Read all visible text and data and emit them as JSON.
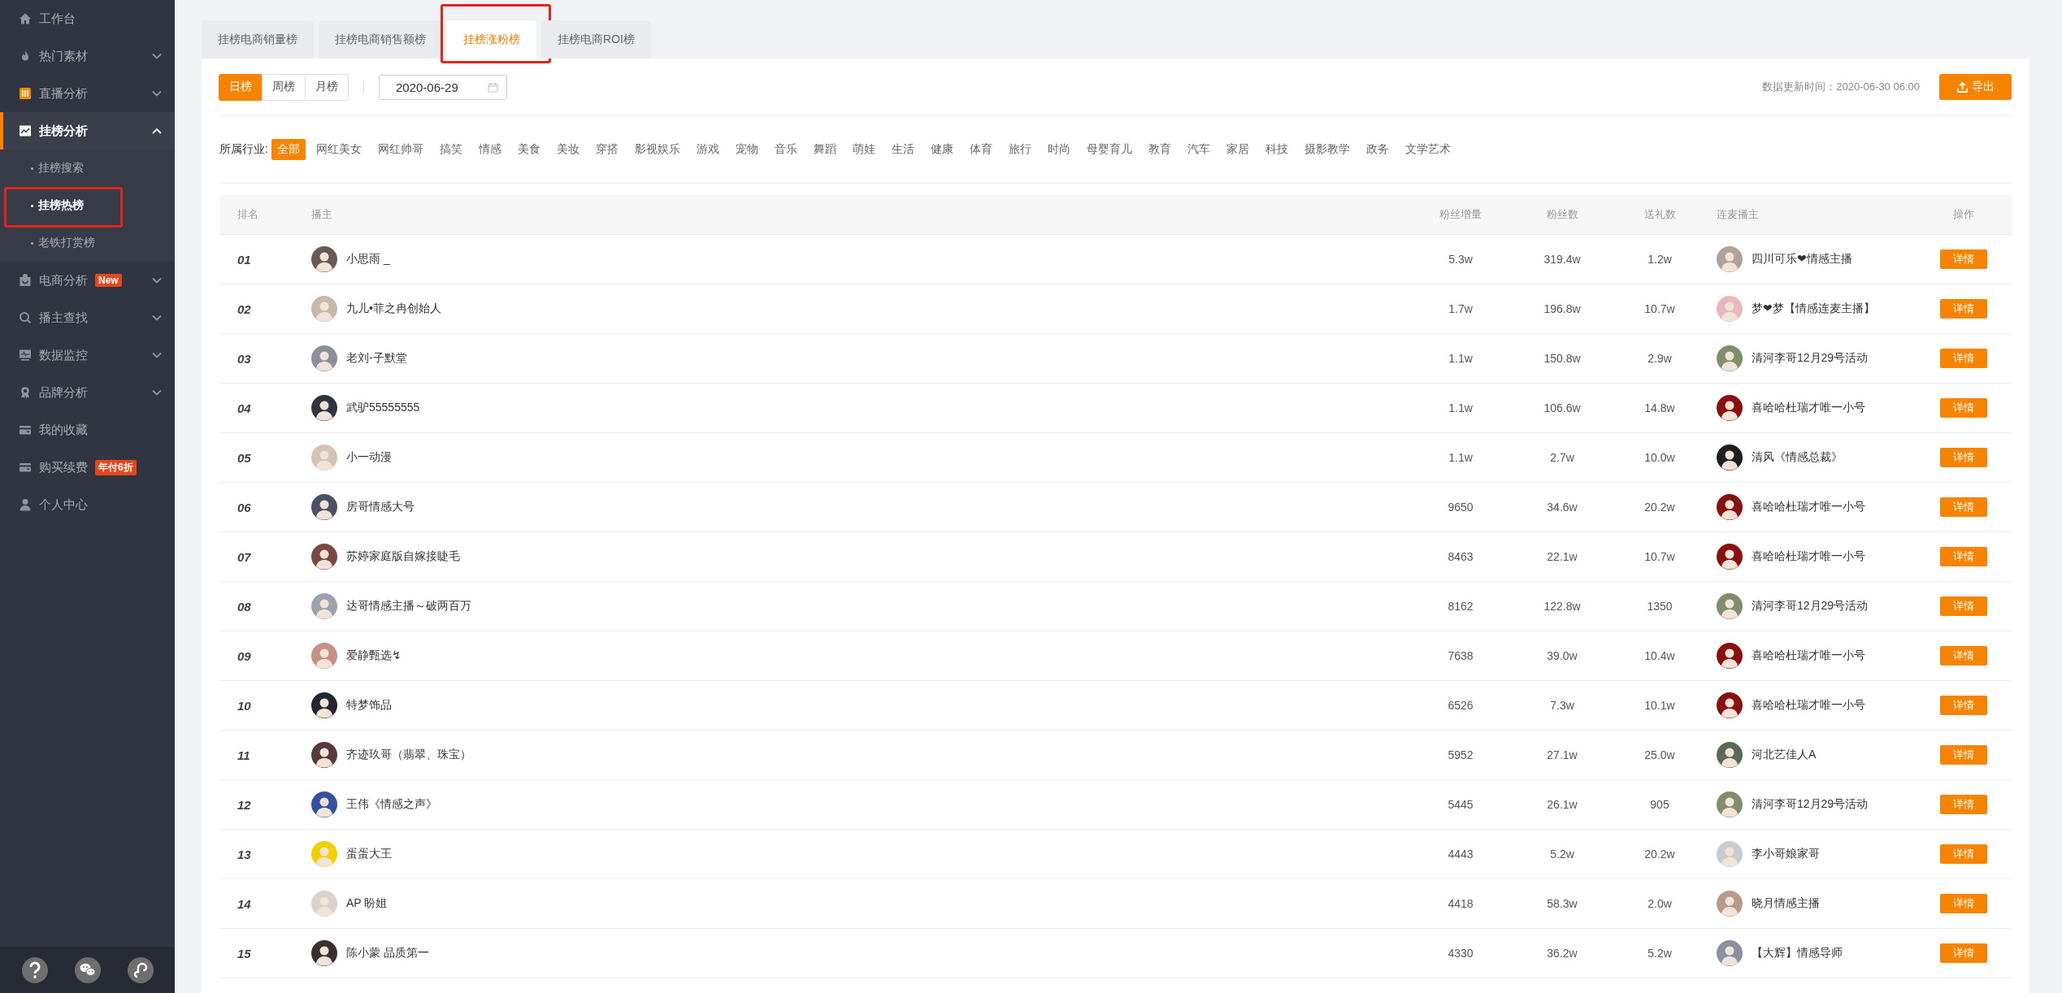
{
  "sidebar": {
    "items": [
      {
        "label": "工作台",
        "selected": false
      },
      {
        "label": "热门素材",
        "selected": false,
        "expanded": false
      },
      {
        "label": "直播分析",
        "selected": false,
        "expanded": false
      },
      {
        "label": "挂榜分析",
        "selected": true,
        "expanded": true,
        "children": [
          {
            "label": "挂榜搜索",
            "selected": false,
            "highlighted": false
          },
          {
            "label": "挂榜热榜",
            "selected": true,
            "highlighted": true
          },
          {
            "label": "老铁打赏榜",
            "selected": false,
            "highlighted": false
          }
        ]
      },
      {
        "label": "电商分析",
        "selected": false,
        "expanded": false,
        "badge": "New"
      },
      {
        "label": "播主查找",
        "selected": false,
        "expanded": false
      },
      {
        "label": "数据监控",
        "selected": false,
        "expanded": false
      },
      {
        "label": "品牌分析",
        "selected": false,
        "expanded": false
      },
      {
        "label": "我的收藏",
        "selected": false
      },
      {
        "label": "购买续费",
        "selected": false,
        "badge": "年付6折"
      },
      {
        "label": "个人中心",
        "selected": false
      }
    ]
  },
  "tabs": [
    {
      "label": "挂榜电商销量榜",
      "selected": false,
      "highlighted": false
    },
    {
      "label": "挂榜电商销售额榜",
      "selected": false,
      "highlighted": false
    },
    {
      "label": "挂榜涨粉榜",
      "selected": true,
      "highlighted": true
    },
    {
      "label": "挂榜电商ROI榜",
      "selected": false,
      "highlighted": false
    }
  ],
  "periods": [
    {
      "label": "日榜",
      "selected": true
    },
    {
      "label": "周榜",
      "selected": false
    },
    {
      "label": "月榜",
      "selected": false
    }
  ],
  "date_field": {
    "value": "2020-06-29"
  },
  "update_time": "数据更新时间：2020-06-30 06:00",
  "export_button": "导出",
  "industry": {
    "label": "所属行业:",
    "options": [
      {
        "label": "全部",
        "selected": true
      },
      {
        "label": "网红美女",
        "selected": false
      },
      {
        "label": "网红帅哥",
        "selected": false
      },
      {
        "label": "搞笑",
        "selected": false
      },
      {
        "label": "情感",
        "selected": false
      },
      {
        "label": "美食",
        "selected": false
      },
      {
        "label": "美妆",
        "selected": false
      },
      {
        "label": "穿搭",
        "selected": false
      },
      {
        "label": "影视娱乐",
        "selected": false
      },
      {
        "label": "游戏",
        "selected": false
      },
      {
        "label": "宠物",
        "selected": false
      },
      {
        "label": "音乐",
        "selected": false
      },
      {
        "label": "舞蹈",
        "selected": false
      },
      {
        "label": "萌娃",
        "selected": false
      },
      {
        "label": "生活",
        "selected": false
      },
      {
        "label": "健康",
        "selected": false
      },
      {
        "label": "体育",
        "selected": false
      },
      {
        "label": "旅行",
        "selected": false
      },
      {
        "label": "时尚",
        "selected": false
      },
      {
        "label": "母婴育儿",
        "selected": false
      },
      {
        "label": "教育",
        "selected": false
      },
      {
        "label": "汽车",
        "selected": false
      },
      {
        "label": "家居",
        "selected": false
      },
      {
        "label": "科技",
        "selected": false
      },
      {
        "label": "摄影教学",
        "selected": false
      },
      {
        "label": "政务",
        "selected": false
      },
      {
        "label": "文学艺术",
        "selected": false
      }
    ]
  },
  "table": {
    "columns": [
      "排名",
      "播主",
      "粉丝增量",
      "粉丝数",
      "送礼数",
      "连麦播主",
      "操作"
    ],
    "rows": [
      {
        "rank": "01",
        "anchor": "小思雨 _",
        "fan_increase": "5.3w",
        "fans": "319.4w",
        "gifts": "1.2w",
        "partner": "四川可乐❤情感主播",
        "action": "详情"
      },
      {
        "rank": "02",
        "anchor": "九儿•菲之冉创始人",
        "fan_increase": "1.7w",
        "fans": "196.8w",
        "gifts": "10.7w",
        "partner": "梦❤梦【情感连麦主播】",
        "action": "详情"
      },
      {
        "rank": "03",
        "anchor": "老刘-子默堂",
        "fan_increase": "1.1w",
        "fans": "150.8w",
        "gifts": "2.9w",
        "partner": "清河李哥12月29号活动",
        "action": "详情"
      },
      {
        "rank": "04",
        "anchor": "武驴55555555",
        "fan_increase": "1.1w",
        "fans": "106.6w",
        "gifts": "14.8w",
        "partner": "喜哈哈杜瑞才唯一小号",
        "action": "详情"
      },
      {
        "rank": "05",
        "anchor": "小一动漫",
        "fan_increase": "1.1w",
        "fans": "2.7w",
        "gifts": "10.0w",
        "partner": "清风《情感总裁》",
        "action": "详情"
      },
      {
        "rank": "06",
        "anchor": "房哥情感大号",
        "fan_increase": "9650",
        "fans": "34.6w",
        "gifts": "20.2w",
        "partner": "喜哈哈杜瑞才唯一小号",
        "action": "详情"
      },
      {
        "rank": "07",
        "anchor": "苏婷家庭版自嫁接睫毛",
        "fan_increase": "8463",
        "fans": "22.1w",
        "gifts": "10.7w",
        "partner": "喜哈哈杜瑞才唯一小号",
        "action": "详情"
      },
      {
        "rank": "08",
        "anchor": "达哥情感主播～破两百万",
        "fan_increase": "8162",
        "fans": "122.8w",
        "gifts": "1350",
        "partner": "清河李哥12月29号活动",
        "action": "详情"
      },
      {
        "rank": "09",
        "anchor": "爱静甄选↯",
        "fan_increase": "7638",
        "fans": "39.0w",
        "gifts": "10.4w",
        "partner": "喜哈哈杜瑞才唯一小号",
        "action": "详情"
      },
      {
        "rank": "10",
        "anchor": "特梦饰品",
        "fan_increase": "6526",
        "fans": "7.3w",
        "gifts": "10.1w",
        "partner": "喜哈哈杜瑞才唯一小号",
        "action": "详情"
      },
      {
        "rank": "11",
        "anchor": "齐迹玖哥（翡翠、珠宝）",
        "fan_increase": "5952",
        "fans": "27.1w",
        "gifts": "25.0w",
        "partner": "河北艺佳人A",
        "action": "详情"
      },
      {
        "rank": "12",
        "anchor": "王伟《情感之声》",
        "fan_increase": "5445",
        "fans": "26.1w",
        "gifts": "905",
        "partner": "清河李哥12月29号活动",
        "action": "详情"
      },
      {
        "rank": "13",
        "anchor": "蛋蛋大王",
        "fan_increase": "4443",
        "fans": "5.2w",
        "gifts": "20.2w",
        "partner": "李小哥娘家哥",
        "action": "详情"
      },
      {
        "rank": "14",
        "anchor": "AP 盼姐",
        "fan_increase": "4418",
        "fans": "58.3w",
        "gifts": "2.0w",
        "partner": "晓月情感主播",
        "action": "详情"
      },
      {
        "rank": "15",
        "anchor": "陈小蒙 品质第一",
        "fan_increase": "4330",
        "fans": "36.2w",
        "gifts": "5.2w",
        "partner": "【大辉】情感导师",
        "action": "详情"
      }
    ]
  }
}
